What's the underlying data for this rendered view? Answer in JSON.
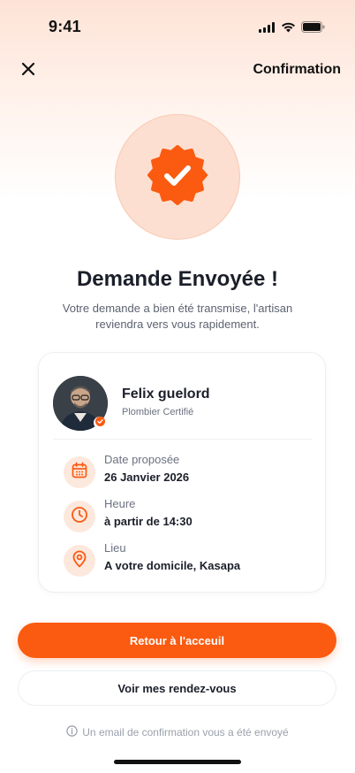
{
  "status_bar": {
    "time": "9:41",
    "icons": [
      "cellular-signal-icon",
      "wifi-icon",
      "battery-icon"
    ]
  },
  "nav": {
    "close_icon": "close-icon",
    "title": "Confirmation"
  },
  "success": {
    "icon": "check-badge-icon",
    "title": "Demande Envoyée !",
    "message": "Votre demande a bien été transmise, l'artisan reviendra vers vous rapidement."
  },
  "professional": {
    "name": "Felix guelord",
    "role": "Plombier Certifié",
    "verified_icon": "verified-icon"
  },
  "details": [
    {
      "icon": "calendar-icon",
      "label": "Date proposée",
      "value": "26 Janvier 2026"
    },
    {
      "icon": "clock-icon",
      "label": "Heure",
      "value": "à partir de 14:30"
    },
    {
      "icon": "location-pin-icon",
      "label": "Lieu",
      "value": "A votre domicile, Kasapa"
    }
  ],
  "actions": {
    "primary_label": "Retour à l'acceuil",
    "secondary_label": "Voir mes rendez-vous"
  },
  "footnote": {
    "icon": "info-icon",
    "text": "Un email de confirmation vous a été envoyé"
  },
  "colors": {
    "accent": "#fb5a11",
    "accent_light": "#fde8dd",
    "badge_bg": "#fcdfd0",
    "text_dark": "#1b1f2a",
    "text_muted": "#6b7280"
  }
}
